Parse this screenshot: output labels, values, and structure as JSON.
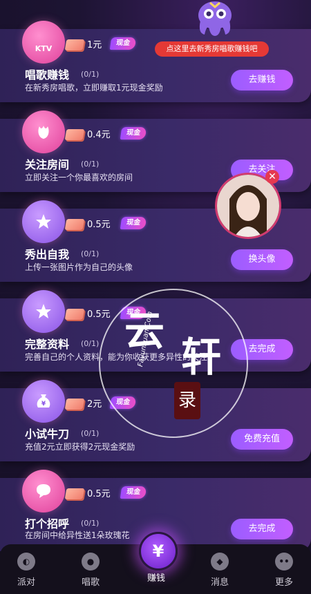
{
  "tooltip": "点这里去新秀房唱歌赚钱吧",
  "tasks": [
    {
      "icon": "ktv-icon",
      "icon_text": "KTV",
      "reward": "1元",
      "badge": "现金",
      "title": "唱歌赚钱",
      "progress": "(0/1)",
      "desc": "在新秀房唱歌，立即赚取1元现金奖励",
      "button": "去赚钱"
    },
    {
      "icon": "tulip-icon",
      "icon_text": "",
      "reward": "0.4元",
      "badge": "现金",
      "title": "关注房间",
      "progress": "(0/1)",
      "desc": "立即关注一个你最喜欢的房间",
      "button": "去关注"
    },
    {
      "icon": "star-icon",
      "icon_text": "",
      "reward": "0.5元",
      "badge": "现金",
      "title": "秀出自我",
      "progress": "(0/1)",
      "desc": "上传一张图片作为自己的头像",
      "button": "换头像"
    },
    {
      "icon": "star-icon",
      "icon_text": "",
      "reward": "0.5元",
      "badge": "现金",
      "title": "完整资料",
      "progress": "(0/1)",
      "desc": "完善自己的个人资料，能为你收获更多异性的关注",
      "button": "去完成"
    },
    {
      "icon": "money-bag-icon",
      "icon_text": "",
      "reward": "2元",
      "badge": "现金",
      "title": "小试牛刀",
      "progress": "(0/1)",
      "desc": "充值2元立即获得2元现金奖励",
      "button": "免费充值"
    },
    {
      "icon": "chat-bubble-icon",
      "icon_text": "",
      "reward": "0.5元",
      "badge": "现金",
      "title": "打个招呼",
      "progress": "(0/1)",
      "desc": "在房间中给异性送1朵玫瑰花",
      "button": "去完成"
    }
  ],
  "watermark": {
    "line1": "云",
    "line2": "轩",
    "seal": "录",
    "url": "Fayunxuan.Com"
  },
  "tabs": [
    {
      "label": "派对",
      "icon": "party-icon"
    },
    {
      "label": "唱歌",
      "icon": "microphone-icon"
    },
    {
      "label": "赚钱",
      "icon": "yen-icon",
      "glyph": "¥"
    },
    {
      "label": "消息",
      "icon": "message-icon"
    },
    {
      "label": "更多",
      "icon": "more-icon"
    }
  ],
  "colors": {
    "accent": "#9b5dff",
    "badge": "#ea4fc7",
    "tooltip": "#e53935"
  }
}
